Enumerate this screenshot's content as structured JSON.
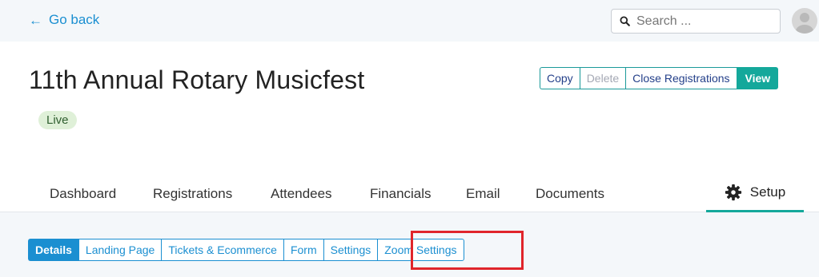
{
  "topbar": {
    "back_label": "Go back",
    "back_icon": "arrow-left-icon",
    "search": {
      "placeholder": "Search ...",
      "value": ""
    },
    "avatar_icon": "user-avatar-icon"
  },
  "event": {
    "title": "11th Annual Rotary Musicfest",
    "status": "Live"
  },
  "actions": {
    "copy": "Copy",
    "delete": "Delete",
    "close_registrations": "Close Registrations",
    "view": "View"
  },
  "main_tabs": {
    "dashboard": "Dashboard",
    "registrations": "Registrations",
    "attendees": "Attendees",
    "financials": "Financials",
    "email": "Email",
    "documents": "Documents",
    "setup": "Setup",
    "active": "Setup"
  },
  "sub_tabs": {
    "details": "Details",
    "landing_page": "Landing Page",
    "tickets": "Tickets & Ecommerce",
    "form": "Form",
    "settings": "Settings",
    "zoom": "Zoom Settings",
    "active": "Details"
  },
  "colors": {
    "link_blue": "#1b8fd1",
    "teal": "#14a89b",
    "highlight_red": "#e0252b",
    "live_badge_bg": "#dff0d8"
  }
}
